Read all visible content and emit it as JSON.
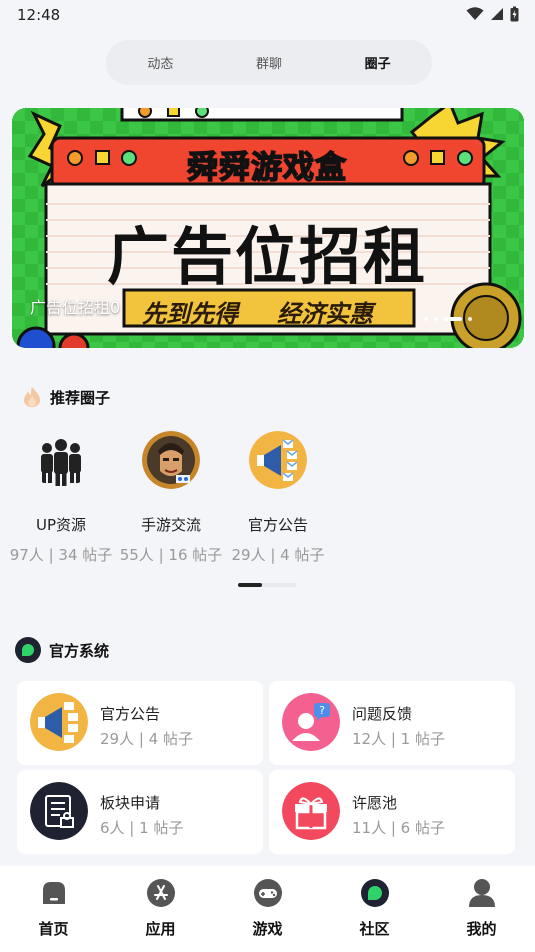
{
  "status": {
    "time": "12:48"
  },
  "top_tabs": [
    {
      "label": "动态",
      "active": false
    },
    {
      "label": "群聊",
      "active": false
    },
    {
      "label": "圈子",
      "active": true
    }
  ],
  "banner": {
    "caption": "广告位招租0",
    "title": "舜舜游戏盒",
    "headline": "广告位招租",
    "slogan_left": "先到先得",
    "slogan_right": "经济实惠",
    "dots_count": 4,
    "active_dot": 3
  },
  "recommended": {
    "title": "推荐圈子",
    "items": [
      {
        "name": "UP资源",
        "stats": "97人 | 34 帖子",
        "icon": "people-group-icon"
      },
      {
        "name": "手游交流",
        "stats": "55人 | 16 帖子",
        "icon": "game-avatar-icon"
      },
      {
        "name": "官方公告",
        "stats": "29人 | 4 帖子",
        "icon": "megaphone-icon"
      }
    ]
  },
  "official": {
    "title": "官方系统",
    "items": [
      {
        "name": "官方公告",
        "stats": "29人 | 4 帖子",
        "icon": "megaphone-icon"
      },
      {
        "name": "问题反馈",
        "stats": "12人 | 1 帖子",
        "icon": "feedback-icon"
      },
      {
        "name": "板块申请",
        "stats": "6人 | 1 帖子",
        "icon": "application-form-icon"
      },
      {
        "name": "许愿池",
        "stats": "11人 | 6 帖子",
        "icon": "gift-icon"
      }
    ]
  },
  "bottom_nav": [
    {
      "label": "首页",
      "icon": "home-icon"
    },
    {
      "label": "应用",
      "icon": "app-store-icon"
    },
    {
      "label": "游戏",
      "icon": "gamepad-icon"
    },
    {
      "label": "社区",
      "icon": "community-icon",
      "active": true
    },
    {
      "label": "我的",
      "icon": "profile-icon"
    }
  ],
  "colors": {
    "background": "#f4f5f9",
    "banner_green": "#2fb83a",
    "banner_red": "#f0452f",
    "megaphone_bg": "#f2b544",
    "feedback_bg": "#f4608f",
    "gift_bg": "#f2495e",
    "form_bg": "#1f2230",
    "community_green": "#2fd36a"
  }
}
